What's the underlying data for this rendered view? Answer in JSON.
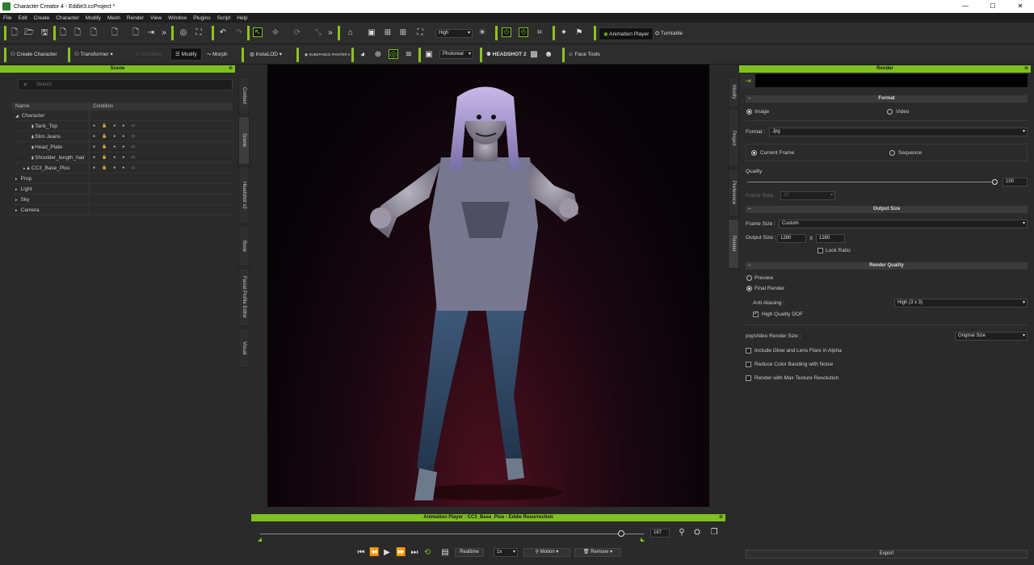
{
  "window": {
    "title": "Character Creator 4 - Eddie3.ccProject *"
  },
  "menu": [
    "File",
    "Edit",
    "Create",
    "Character",
    "Modify",
    "Mesh",
    "Render",
    "View",
    "Window",
    "Plugins",
    "Script",
    "Help"
  ],
  "toolbar1": {
    "quality": "High",
    "animation_player": "Animation Player",
    "turntable": "Turntable"
  },
  "toolbar2": {
    "create_character": "Create Character",
    "transformer": "Transformer",
    "conform": "Conform",
    "modify": "Modify",
    "morph": "Morph",
    "instalod": "InstaLOD",
    "substance": "SUBSTANCE PAINTER",
    "shader": "Photoreal",
    "headshot": "HEADSHOT 2",
    "face_tools": "Face Tools"
  },
  "scene": {
    "title": "Scene",
    "search_placeholder": "Search",
    "col_name": "Name",
    "col_condition": "Condition",
    "items": [
      {
        "label": "Character",
        "indent": 0,
        "arrow": "◢"
      },
      {
        "label": "Tank_Top",
        "indent": 2,
        "arrow": ""
      },
      {
        "label": "Slim Jeans",
        "indent": 2,
        "arrow": ""
      },
      {
        "label": "Head_Plate",
        "indent": 2,
        "arrow": ""
      },
      {
        "label": "Shoulder_length_hair",
        "indent": 2,
        "arrow": ""
      },
      {
        "label": "CC3_Base_Plus",
        "indent": 1,
        "arrow": "▸"
      },
      {
        "label": "Prop",
        "indent": 0,
        "arrow": "▸"
      },
      {
        "label": "Light",
        "indent": 0,
        "arrow": "▸"
      },
      {
        "label": "Sky",
        "indent": 0,
        "arrow": "▸"
      },
      {
        "label": "Camera",
        "indent": 0,
        "arrow": "▸"
      }
    ]
  },
  "side_tabs": [
    "Content",
    "Scene",
    "Headshot v2",
    "Bone",
    "Facial Profile Editor",
    "Visual"
  ],
  "right_tabs": [
    "Modify",
    "Project",
    "Preference",
    "Render"
  ],
  "anim_player": {
    "title": "Animation Player : CC3_Base_Plus - Eddie Resurrection",
    "frame": "187",
    "realtime": "Realtime",
    "speed": "1x",
    "motion": "Motion",
    "remove": "Remove",
    "progress": 0.94
  },
  "render": {
    "title": "Render",
    "format_head": "Format",
    "image": "Image",
    "video": "Video",
    "format_label": "Format :",
    "format_value": "Jpg",
    "current_frame": "Current Frame",
    "sequence": "Sequence",
    "quality_label": "Quality",
    "quality_value": "100",
    "frame_rate_label": "Frame Rate :",
    "frame_rate_value": "30",
    "output_head": "Output Size",
    "frame_size_label": "Frame Size :",
    "frame_size_value": "Custom",
    "output_size_label": "Output Size :",
    "width": "1280",
    "x": "X",
    "height": "1280",
    "lock_ratio": "Lock Ratio",
    "quality_head": "Render Quality",
    "preview": "Preview",
    "final_render": "Final Render",
    "aa_label": "Anti Aliasing :",
    "aa_value": "High (3 x 3)",
    "hq_dof": "High Quality DOF",
    "popvideo_label": "popVideo Render Size :",
    "popvideo_value": "Original Size",
    "glow": "Include Glow and Lens Flare in Alpha",
    "banding": "Reduce Color Banding with Noise",
    "max_tex": "Render with Max Texture Resolution",
    "export": "Export"
  }
}
